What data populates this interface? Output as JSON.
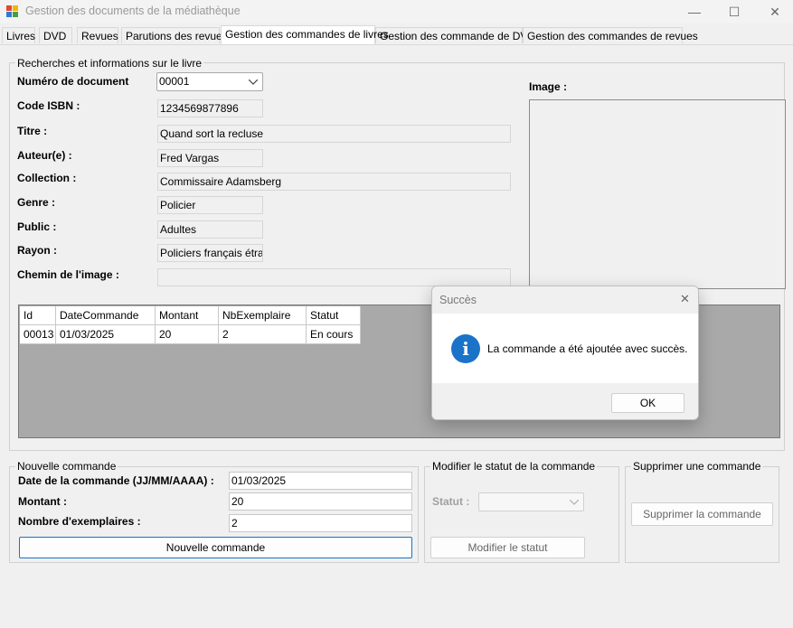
{
  "window": {
    "title": "Gestion des documents de la médiathèque",
    "minimize": "—",
    "maximize": "☐",
    "close": "✕"
  },
  "tabs": [
    {
      "label": "Livres"
    },
    {
      "label": "DVD"
    },
    {
      "label": "Revues"
    },
    {
      "label": "Parutions des revues"
    },
    {
      "label": "Gestion des commandes de livres"
    },
    {
      "label": "Gestion des commande de DVD"
    },
    {
      "label": "Gestion des commandes de revues"
    }
  ],
  "book_info": {
    "legend": "Recherches et informations sur le livre",
    "doc_number_label": "Numéro de document",
    "doc_number_value": "00001",
    "isbn_label": "Code ISBN :",
    "isbn_value": "1234569877896",
    "title_label": "Titre :",
    "title_value": "Quand sort la recluse",
    "author_label": "Auteur(e) :",
    "author_value": "Fred Vargas",
    "collection_label": "Collection :",
    "collection_value": "Commissaire Adamsberg",
    "genre_label": "Genre :",
    "genre_value": "Policier",
    "public_label": "Public :",
    "public_value": "Adultes",
    "rayon_label": "Rayon :",
    "rayon_value": "Policiers français étrang",
    "image_path_label": "Chemin de l'image :",
    "image_path_value": "",
    "image_label": "Image :"
  },
  "orders_grid": {
    "columns": [
      "Id",
      "DateCommande",
      "Montant",
      "NbExemplaire",
      "Statut"
    ],
    "rows": [
      [
        "00013",
        "01/03/2025",
        "20",
        "2",
        "En cours"
      ]
    ]
  },
  "new_order": {
    "legend": "Nouvelle commande",
    "date_label": "Date de la commande (JJ/MM/AAAA) :",
    "date_value": "01/03/2025",
    "amount_label": "Montant :",
    "amount_value": "20",
    "copies_label": "Nombre d'exemplaires :",
    "copies_value": "2",
    "submit_label": "Nouvelle commande"
  },
  "modify_status": {
    "legend": "Modifier le statut de la commande",
    "status_label": "Statut :",
    "status_value": "",
    "submit_label": "Modifier le statut"
  },
  "delete_order": {
    "legend": "Supprimer une commande",
    "submit_label": "Supprimer la commande"
  },
  "dialog": {
    "title": "Succès",
    "message": "La commande a été ajoutée avec succès.",
    "ok_label": "OK",
    "close": "✕",
    "icon_glyph": "i",
    "icon_color": "#1a73c8"
  }
}
